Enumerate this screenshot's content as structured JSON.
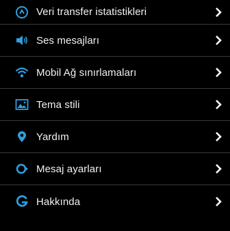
{
  "accent_color": "#2f9fe0",
  "menu": {
    "items": [
      {
        "label": "Veri transfer istatistikleri",
        "icon": "data-stats-icon"
      },
      {
        "label": "Ses mesajları",
        "icon": "speaker-icon"
      },
      {
        "label": "Mobil Ağ sınırlamaları",
        "icon": "wifi-icon"
      },
      {
        "label": "Tema stili",
        "icon": "image-icon"
      },
      {
        "label": "Yardım",
        "icon": "location-pin-icon"
      },
      {
        "label": "Mesaj ayarları",
        "icon": "message-settings-icon"
      },
      {
        "label": "Hakkında",
        "icon": "about-icon"
      }
    ]
  }
}
